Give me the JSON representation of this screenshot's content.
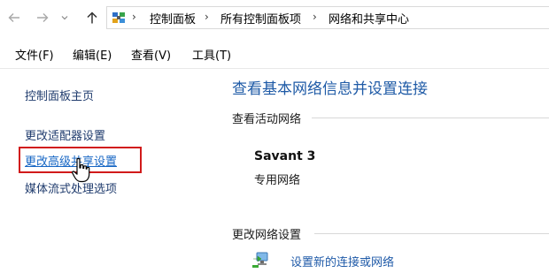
{
  "address_bar": {
    "back_icon": "arrow-left-icon",
    "forward_icon": "arrow-right-icon",
    "history_dropdown_icon": "chevron-down-icon",
    "up_icon": "arrow-up-icon",
    "location_icon": "control-panel-icon",
    "separator": "›",
    "breadcrumbs": [
      "控制面板",
      "所有控制面板项",
      "网络和共享中心"
    ]
  },
  "menu": {
    "items": [
      "文件(F)",
      "编辑(E)",
      "查看(V)",
      "工具(T)"
    ]
  },
  "sidebar": {
    "items": [
      "控制面板主页",
      "更改适配器设置",
      "更改高级共享设置",
      "媒体流式处理选项"
    ],
    "highlighted_item": "更改高级共享设置",
    "highlight_color": "#d11a1a"
  },
  "main": {
    "title": "查看基本网络信息并设置连接",
    "active_networks_header": "查看活动网络",
    "network": {
      "name": "Savant 3",
      "type": "专用网络"
    },
    "change_settings_header": "更改网络设置",
    "setup_link": "设置新的连接或网络",
    "setup_icon": "network-setup-icon"
  },
  "colors": {
    "title_blue": "#1e5aa6",
    "link_blue": "#1f5aa8",
    "hover_link_blue": "#1666c4"
  }
}
